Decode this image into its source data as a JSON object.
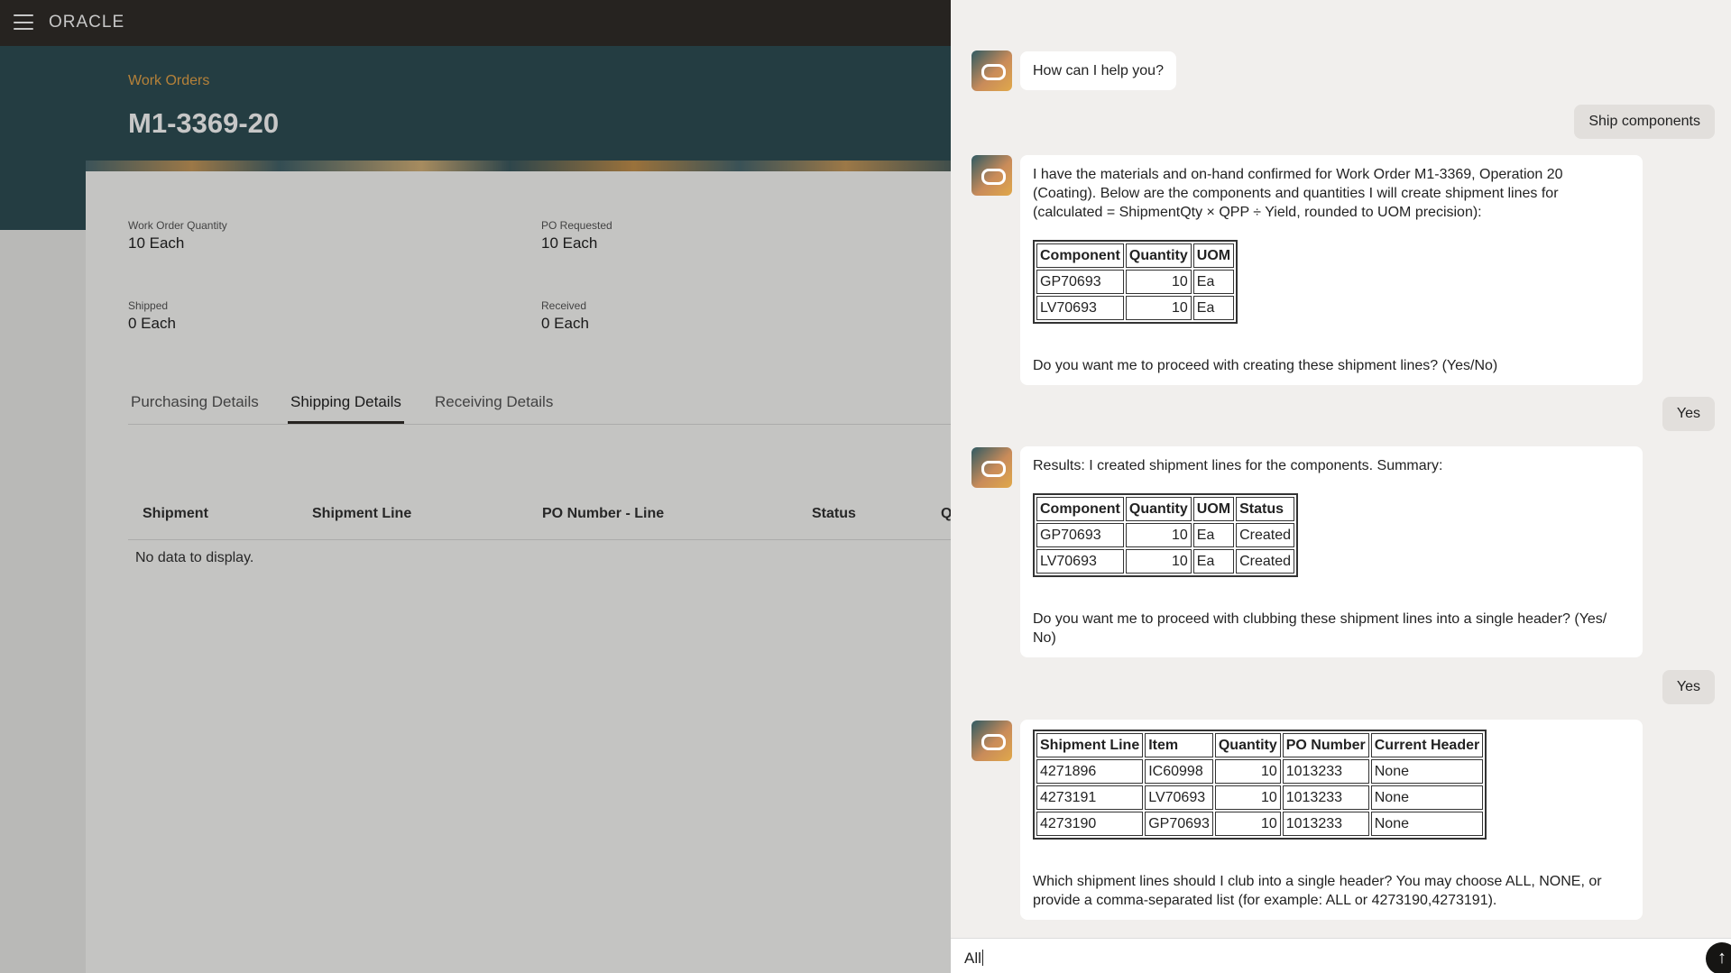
{
  "app": {
    "logo": "ORACLE",
    "breadcrumb": "Work Orders",
    "title": "M1-3369-20",
    "fields": {
      "work_order_quantity": {
        "label": "Work Order Quantity",
        "value": "10 Each"
      },
      "po_requested": {
        "label": "PO Requested",
        "value": "10 Each"
      },
      "shipped": {
        "label": "Shipped",
        "value": "0 Each"
      },
      "received": {
        "label": "Received",
        "value": "0 Each"
      }
    },
    "tabs": [
      "Purchasing Details",
      "Shipping Details",
      "Receiving Details"
    ],
    "active_tab": "Shipping Details",
    "grid_columns": [
      "Shipment",
      "Shipment Line",
      "PO Number - Line",
      "Status",
      "Q"
    ],
    "empty_text": "No data to display."
  },
  "chat": {
    "greeting": "How can I help you?",
    "user_msg_1": "Ship components",
    "bot_msg_2": {
      "intro": "I have the materials and on-hand confirmed for Work Order M1-3369, Operation 20 (Coating). Below are the components and quantities I will create shipment lines for (calculated = ShipmentQty × QPP ÷ Yield, rounded to UOM precision):",
      "table": {
        "headers": [
          "Component",
          "Quantity",
          "UOM"
        ],
        "rows": [
          [
            "GP70693",
            "10",
            "Ea"
          ],
          [
            "LV70693",
            "10",
            "Ea"
          ]
        ]
      },
      "question": "Do you want me to proceed with creating these shipment lines? (Yes/No)"
    },
    "user_msg_2": "Yes",
    "bot_msg_3": {
      "intro": "Results: I created shipment lines for the components. Summary:",
      "table": {
        "headers": [
          "Component",
          "Quantity",
          "UOM",
          "Status"
        ],
        "rows": [
          [
            "GP70693",
            "10",
            "Ea",
            "Created"
          ],
          [
            "LV70693",
            "10",
            "Ea",
            "Created"
          ]
        ]
      },
      "question": "Do you want me to proceed with clubbing these shipment lines into a single header? (Yes/ No)"
    },
    "user_msg_3": "Yes",
    "bot_msg_4": {
      "table": {
        "headers": [
          "Shipment Line",
          "Item",
          "Quantity",
          "PO Number",
          "Current Header"
        ],
        "rows": [
          [
            "4271896",
            "IC60998",
            "10",
            "1013233",
            "None"
          ],
          [
            "4273191",
            "LV70693",
            "10",
            "1013233",
            "None"
          ],
          [
            "4273190",
            "GP70693",
            "10",
            "1013233",
            "None"
          ]
        ]
      },
      "question": "Which shipment lines should I club into a single header? You may choose ALL, NONE, or provide a comma-separated list (for example: ALL or 4273190,4273191)."
    },
    "input_value": "All",
    "send_icon": "arrow-up-icon"
  }
}
